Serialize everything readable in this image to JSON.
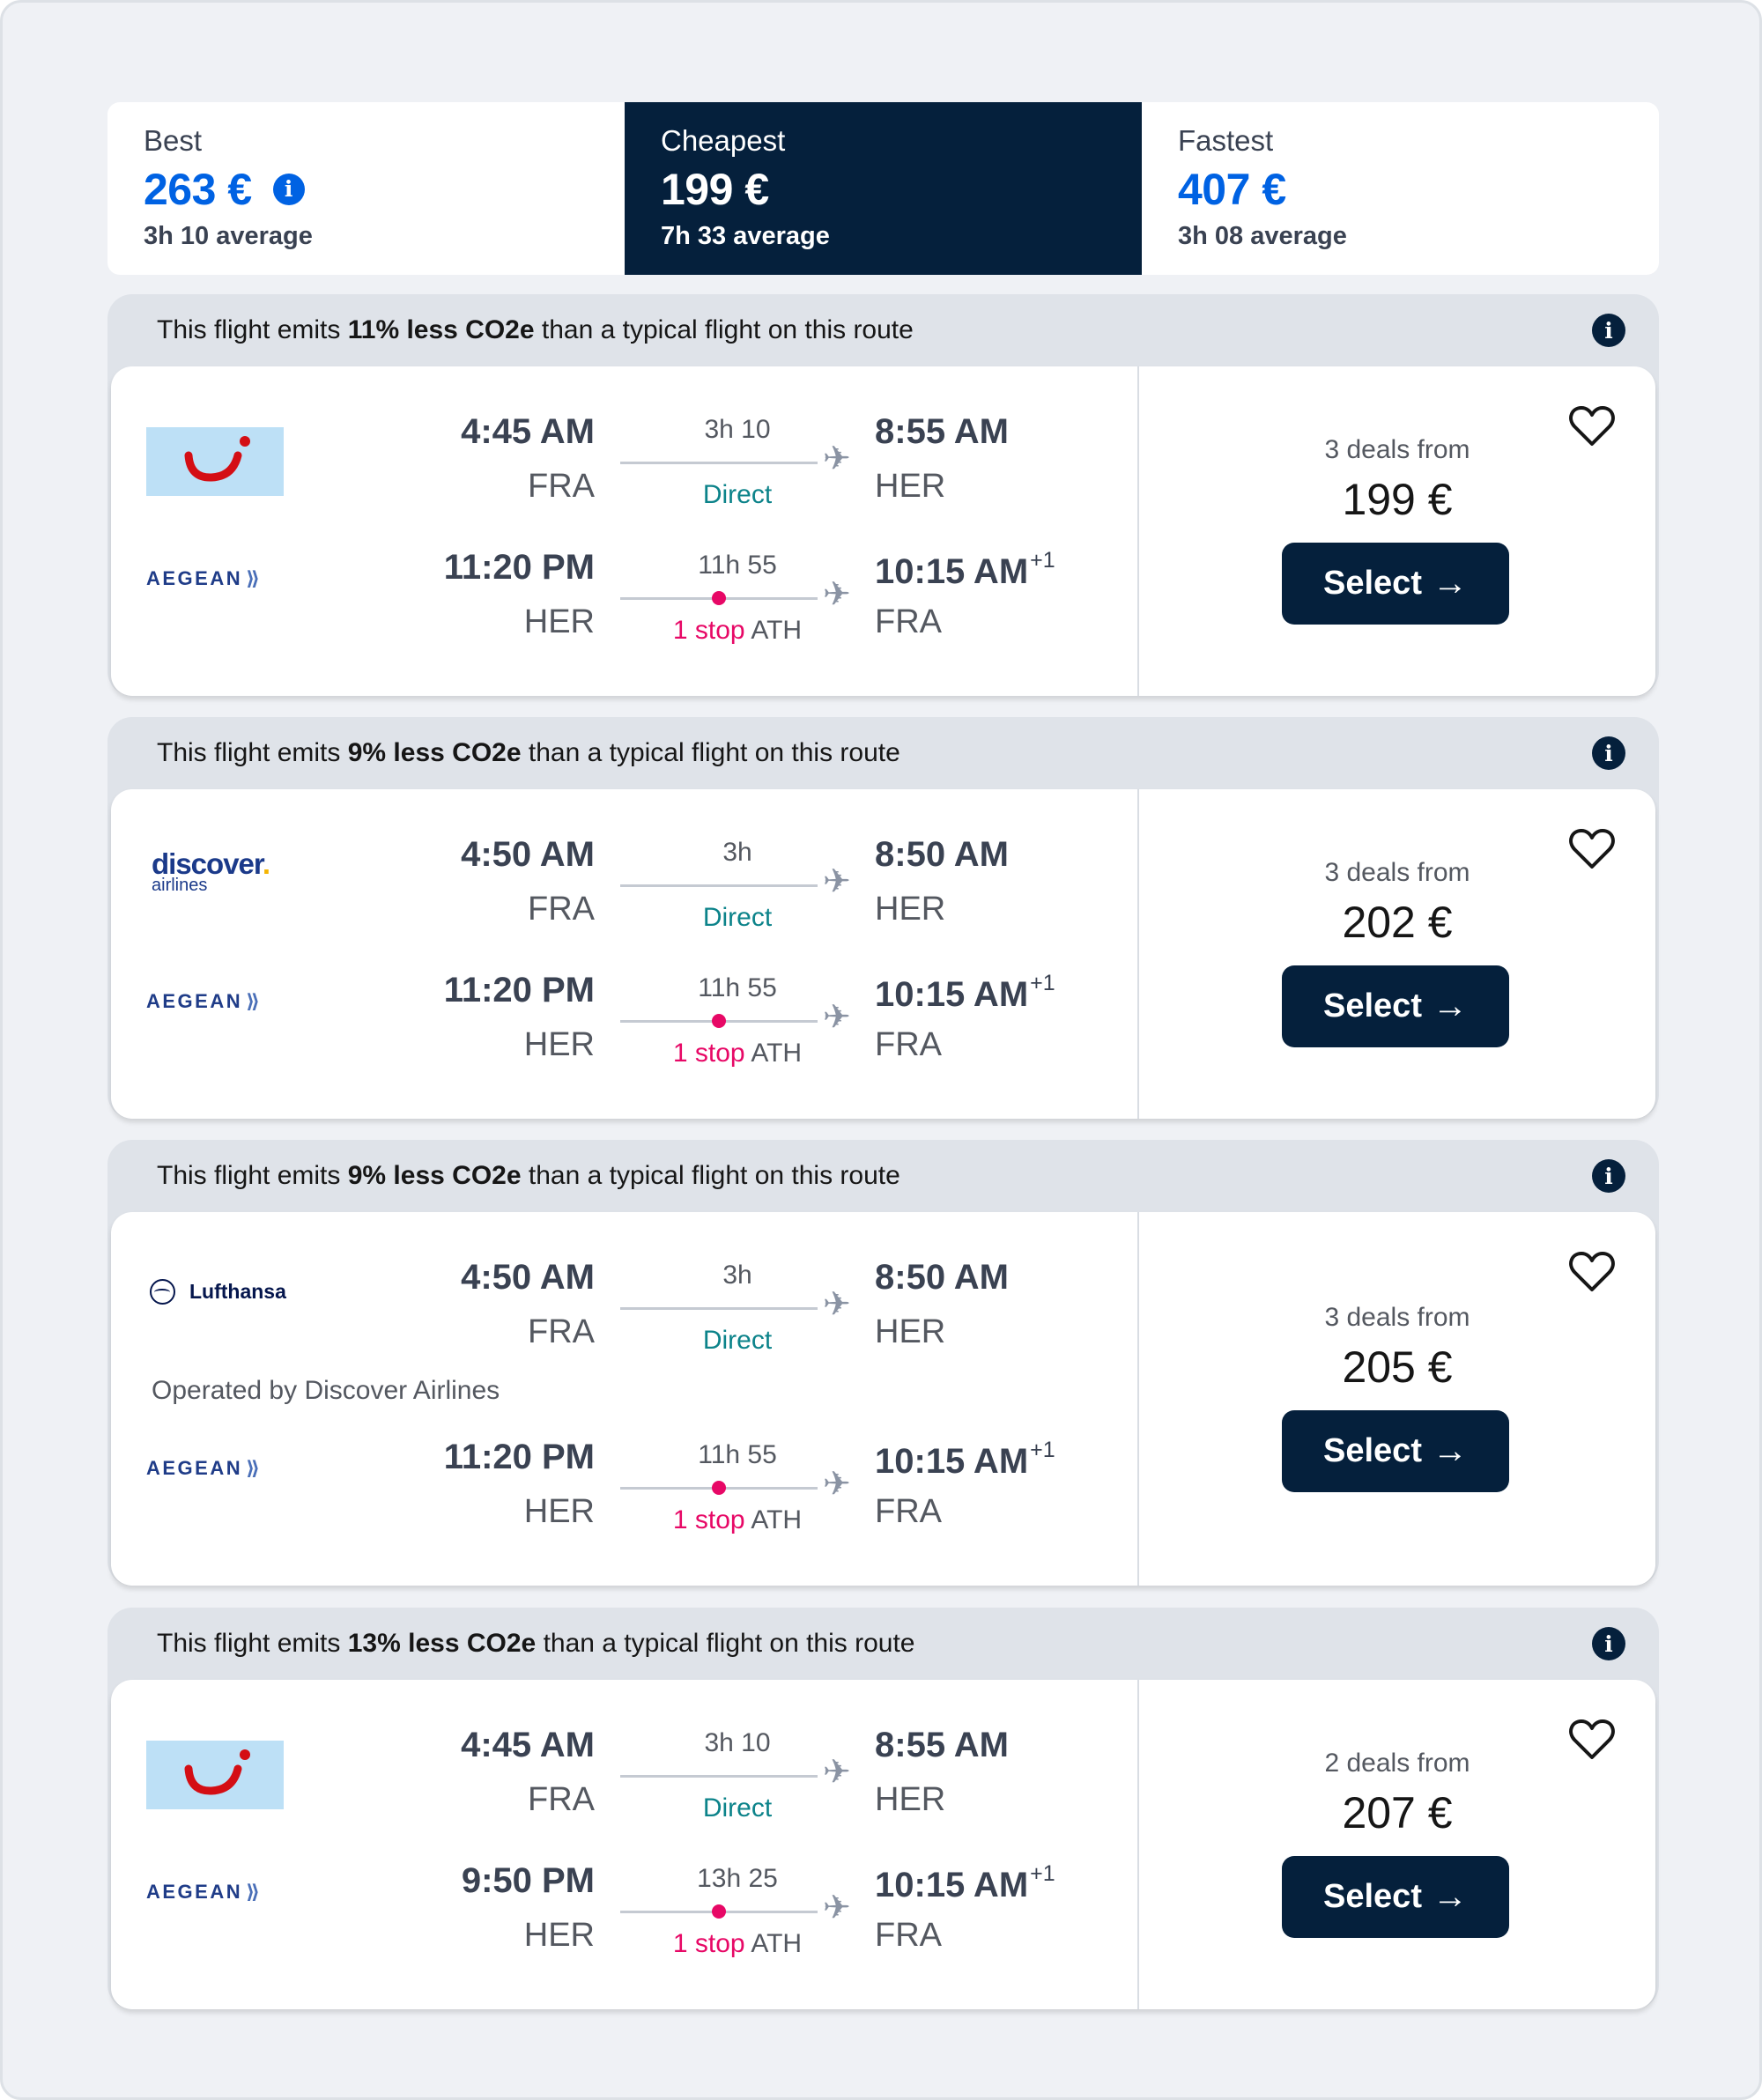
{
  "sort_tabs": [
    {
      "label": "Best",
      "price": "263 €",
      "average": "3h 10 average",
      "has_info": true
    },
    {
      "label": "Cheapest",
      "price": "199 €",
      "average": "7h 33 average",
      "active": true
    },
    {
      "label": "Fastest",
      "price": "407 €",
      "average": "3h 08 average"
    }
  ],
  "results": [
    {
      "co2": {
        "prefix": "This flight emits",
        "highlight": "11% less CO2e",
        "suffix": "than a typical flight on this route"
      },
      "outbound": {
        "airline": "TUI",
        "dep_time": "4:45 AM",
        "dep_code": "FRA",
        "duration": "3h 10",
        "stops": "Direct",
        "arr_time": "8:55 AM",
        "arr_code": "HER"
      },
      "inbound": {
        "airline": "AEGEAN",
        "dep_time": "11:20 PM",
        "dep_code": "HER",
        "duration": "11h 55",
        "stops": "1 stop",
        "via": "ATH",
        "arr_time": "10:15 AM",
        "day_offset": "+1",
        "arr_code": "FRA"
      },
      "deals": "3 deals from",
      "price": "199 €",
      "select": "Select"
    },
    {
      "co2": {
        "prefix": "This flight emits",
        "highlight": "9% less CO2e",
        "suffix": "than a typical flight on this route"
      },
      "outbound": {
        "airline": "discover airlines",
        "dep_time": "4:50 AM",
        "dep_code": "FRA",
        "duration": "3h",
        "stops": "Direct",
        "arr_time": "8:50 AM",
        "arr_code": "HER"
      },
      "inbound": {
        "airline": "AEGEAN",
        "dep_time": "11:20 PM",
        "dep_code": "HER",
        "duration": "11h 55",
        "stops": "1 stop",
        "via": "ATH",
        "arr_time": "10:15 AM",
        "day_offset": "+1",
        "arr_code": "FRA"
      },
      "deals": "3 deals from",
      "price": "202 €",
      "select": "Select"
    },
    {
      "co2": {
        "prefix": "This flight emits",
        "highlight": "9% less CO2e",
        "suffix": "than a typical flight on this route"
      },
      "outbound": {
        "airline": "Lufthansa",
        "dep_time": "4:50 AM",
        "dep_code": "FRA",
        "duration": "3h",
        "stops": "Direct",
        "arr_time": "8:50 AM",
        "arr_code": "HER"
      },
      "operated_by": "Operated by Discover Airlines",
      "inbound": {
        "airline": "AEGEAN",
        "dep_time": "11:20 PM",
        "dep_code": "HER",
        "duration": "11h 55",
        "stops": "1 stop",
        "via": "ATH",
        "arr_time": "10:15 AM",
        "day_offset": "+1",
        "arr_code": "FRA"
      },
      "deals": "3 deals from",
      "price": "205 €",
      "select": "Select"
    },
    {
      "co2": {
        "prefix": "This flight emits",
        "highlight": "13% less CO2e",
        "suffix": "than a typical flight on this route"
      },
      "outbound": {
        "airline": "TUI",
        "dep_time": "4:45 AM",
        "dep_code": "FRA",
        "duration": "3h 10",
        "stops": "Direct",
        "arr_time": "8:55 AM",
        "arr_code": "HER"
      },
      "inbound": {
        "airline": "AEGEAN",
        "dep_time": "9:50 PM",
        "dep_code": "HER",
        "duration": "13h 25",
        "stops": "1 stop",
        "via": "ATH",
        "arr_time": "10:15 AM",
        "day_offset": "+1",
        "arr_code": "FRA"
      },
      "deals": "2 deals from",
      "price": "207 €",
      "select": "Select"
    }
  ],
  "colors": {
    "navy": "#05203c",
    "blue": "#0062e3",
    "direct_green": "#0c838a",
    "stop_pink": "#e70866"
  },
  "icons": {
    "info": "info-icon",
    "heart": "heart-icon",
    "plane": "plane-icon",
    "arrow": "arrow-right-icon"
  }
}
